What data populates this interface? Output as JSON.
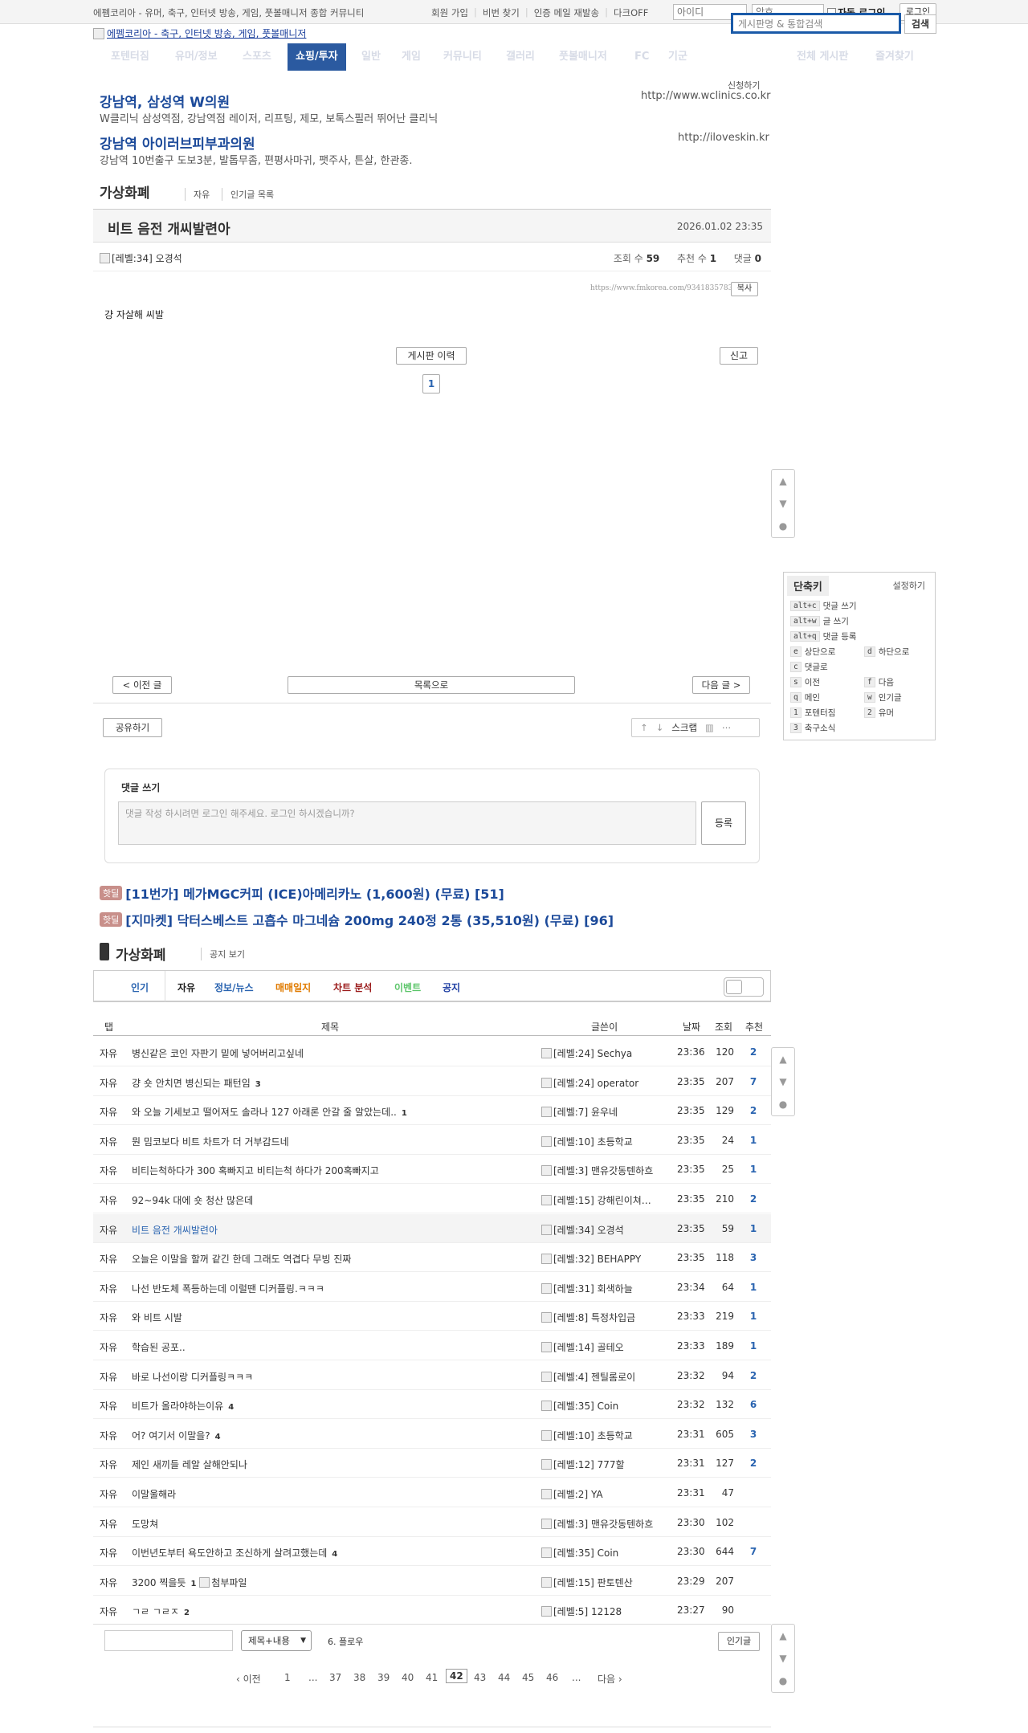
{
  "top": {
    "site_desc": "에펨코리아 - 유머, 축구, 인터넷 방송, 게임, 풋볼매니저 종합 커뮤니티",
    "links": [
      "회원 가입",
      "비번 찾기",
      "인증 메일 재발송",
      "다크OFF"
    ],
    "id_placeholder": "아이디",
    "pw_placeholder": "암호",
    "auto_login": "자동 로그인",
    "login": "로그인"
  },
  "header": {
    "logo_alt": "에펨코리아 - 축구, 인터넷 방송, 게임, 풋볼매니저",
    "search_placeholder": "게시판명 & 통합검색",
    "search_btn": "검색"
  },
  "nav": {
    "items": [
      "포텐터짐",
      "유머/정보",
      "스포츠",
      "쇼핑/투자",
      "일반",
      "게임",
      "커뮤니티",
      "갤러리",
      "풋볼매니저",
      "FC",
      "기군"
    ],
    "right": [
      "전체 게시판",
      "즐겨찾기"
    ]
  },
  "ads": {
    "apply": "신청하기",
    "items": [
      {
        "title": "강남역, 삼성역 W의원",
        "desc": "W클리닉 삼성역점, 강남역점 레이저, 리프팅, 제모, 보톡스필러 뛰어난 클리닉",
        "url": "http://www.wclinics.co.kr"
      },
      {
        "title": "강남역 아이러브피부과의원",
        "desc": "강남역 10번출구 도보3분, 발톱무좀, 편평사마귀, 팻주사, 튼살, 한관종.",
        "url": "http://iloveskin.kr"
      }
    ]
  },
  "board": {
    "name": "가상화폐",
    "sub1": "자유",
    "sub2": "인기글 목록"
  },
  "post": {
    "title": "비트 음전 개씨발련아",
    "date": "2026.01.02 23:35",
    "author_level": "[레벨:34]",
    "author": "오경석",
    "views_label": "조회 수",
    "views": "59",
    "rec_label": "추천 수",
    "rec": "1",
    "cmt_label": "댓글",
    "cmt": "0",
    "url": "https://www.fmkorea.com/9341835783",
    "copy": "복사",
    "body": "걍 자살해 씨발",
    "history_btn": "게시판 이력",
    "report_btn": "신고",
    "page_num": "1"
  },
  "post_nav": {
    "prev": "< 이전 글",
    "list": "목록으로",
    "next": "다음 글 >",
    "share": "공유하기",
    "scrap": "스크랩"
  },
  "shortcut": {
    "title": "단축키",
    "settings": "설정하기",
    "rows": [
      {
        "key": "alt+c",
        "label": "댓글 쓰기"
      },
      {
        "key": "alt+w",
        "label": "글 쓰기"
      },
      {
        "key": "alt+q",
        "label": "댓글 등록"
      }
    ],
    "pairs": [
      [
        {
          "key": "e",
          "label": "상단으로"
        },
        {
          "key": "d",
          "label": "하단으로"
        }
      ],
      [
        {
          "key": "c",
          "label": "댓글로"
        },
        null
      ],
      [
        {
          "key": "s",
          "label": "이전"
        },
        {
          "key": "f",
          "label": "다음"
        }
      ],
      [
        {
          "key": "q",
          "label": "메인"
        },
        {
          "key": "w",
          "label": "인기글"
        }
      ],
      [
        {
          "key": "1",
          "label": "포텐터짐"
        },
        {
          "key": "2",
          "label": "유머"
        }
      ],
      [
        {
          "key": "3",
          "label": "축구소식"
        },
        null
      ]
    ]
  },
  "comment": {
    "title": "댓글 쓰기",
    "placeholder": "댓글 작성 하시려면 로그인 해주세요. 로그인 하시겠습니까?",
    "submit": "등록"
  },
  "hotdeals": [
    {
      "tag": "핫딜",
      "text": "[11번가] 메가MGC커피 (ICE)아메리카노 (1,600원) (무료) [51]"
    },
    {
      "tag": "핫딜",
      "text": "[지마켓] 닥터스베스트 고흡수 마그네슘 200mg 240정 2통 (35,510원) (무료) [96]"
    }
  ],
  "list_board": {
    "name": "가상화폐",
    "notice_link": "공지 보기",
    "tabs": [
      {
        "label": "인기",
        "color": "#2a64b0"
      },
      {
        "label": "자유",
        "color": "#222222"
      },
      {
        "label": "정보/뉴스",
        "color": "#2a64b0"
      },
      {
        "label": "매매일지",
        "color": "#e07b00"
      },
      {
        "label": "차트 분석",
        "color": "#9b1c1c"
      },
      {
        "label": "이벤트",
        "color": "#5cc56a"
      },
      {
        "label": "공지",
        "color": "#1f3fa3"
      }
    ],
    "headers": {
      "cat": "탭",
      "title": "제목",
      "author": "글쓴이",
      "date": "날짜",
      "views": "조회",
      "rec": "추천"
    }
  },
  "rows": [
    {
      "cat": "자유",
      "title": "병신같은 코인 자판기 밑에 넣어버리고싶네",
      "cnt": "",
      "level": "[레벨:24]",
      "author": "Sechya",
      "time": "23:36",
      "views": "120",
      "rec": "2"
    },
    {
      "cat": "자유",
      "title": "걍 숏 안치면 병신되는 패턴임",
      "cnt": "3",
      "level": "[레벨:24]",
      "author": "operator",
      "time": "23:35",
      "views": "207",
      "rec": "7"
    },
    {
      "cat": "자유",
      "title": "와 오늘 기세보고 떨어져도 솔라나 127 아래론 안갈 줄 알았는데..",
      "cnt": "1",
      "level": "[레벨:7]",
      "author": "윤우네",
      "time": "23:35",
      "views": "129",
      "rec": "2"
    },
    {
      "cat": "자유",
      "title": "뭔 밈코보다 비트 차트가 더 거부감드네",
      "cnt": "",
      "level": "[레벨:10]",
      "author": "초등학교",
      "time": "23:35",
      "views": "24",
      "rec": "1"
    },
    {
      "cat": "자유",
      "title": "비티는척하다가 300 혹빠지고 비티는척 하다가 200혹빠지고",
      "cnt": "",
      "level": "[레벨:3]",
      "author": "맨유갓동텐하흐",
      "time": "23:35",
      "views": "25",
      "rec": "1"
    },
    {
      "cat": "자유",
      "title": "92~94k 대에 숏 청산 많은데",
      "cnt": "",
      "level": "[레벨:15]",
      "author": "강해린이쳐…",
      "time": "23:35",
      "views": "210",
      "rec": "2"
    },
    {
      "cat": "자유",
      "title": "비트 음전 개씨발련아",
      "cnt": "",
      "level": "[레벨:34]",
      "author": "오경석",
      "time": "23:35",
      "views": "59",
      "rec": "1",
      "current": true
    },
    {
      "cat": "자유",
      "title": "오늘은 이말을 할꺼 같긴 한데 그래도 역겹다 무빙 진짜",
      "cnt": "",
      "level": "[레벨:32]",
      "author": "BEHAPPY",
      "time": "23:35",
      "views": "118",
      "rec": "3"
    },
    {
      "cat": "자유",
      "title": "나선 반도체 폭등하는데 이럴땐 디커플링.ㅋㅋㅋ",
      "cnt": "",
      "level": "[레벨:31]",
      "author": "회색하늘",
      "time": "23:34",
      "views": "64",
      "rec": "1"
    },
    {
      "cat": "자유",
      "title": "와 비트 시발",
      "cnt": "",
      "level": "[레벨:8]",
      "author": "특정차입금",
      "time": "23:33",
      "views": "219",
      "rec": "1"
    },
    {
      "cat": "자유",
      "title": "학습된 공포..",
      "cnt": "",
      "level": "[레벨:14]",
      "author": "골테오",
      "time": "23:33",
      "views": "189",
      "rec": "1"
    },
    {
      "cat": "자유",
      "title": "바로 나선이랑 디커플링ㅋㅋㅋ",
      "cnt": "",
      "level": "[레벨:4]",
      "author": "젠틸롬로이",
      "time": "23:32",
      "views": "94",
      "rec": "2"
    },
    {
      "cat": "자유",
      "title": "비트가 올라야하는이유",
      "cnt": "4",
      "level": "[레벨:35]",
      "author": "Coin",
      "time": "23:32",
      "views": "132",
      "rec": "6"
    },
    {
      "cat": "자유",
      "title": "어? 여기서 이말을?",
      "cnt": "4",
      "level": "[레벨:10]",
      "author": "초등학교",
      "time": "23:31",
      "views": "605",
      "rec": "3"
    },
    {
      "cat": "자유",
      "title": "제인 새끼들 레알 살해안되나",
      "cnt": "",
      "level": "[레벨:12]",
      "author": "777할",
      "time": "23:31",
      "views": "127",
      "rec": "2"
    },
    {
      "cat": "자유",
      "title": "이말울해라",
      "cnt": "",
      "level": "[레벨:2]",
      "author": "YA",
      "time": "23:31",
      "views": "47",
      "rec": ""
    },
    {
      "cat": "자유",
      "title": "도망쳐",
      "cnt": "",
      "level": "[레벨:3]",
      "author": "맨유갓동텐하흐",
      "time": "23:30",
      "views": "102",
      "rec": ""
    },
    {
      "cat": "자유",
      "title": "이번년도부터 욕도안하고 조신하게 살려고했는데",
      "cnt": "4",
      "level": "[레벨:35]",
      "author": "Coin",
      "time": "23:30",
      "views": "644",
      "rec": "7"
    },
    {
      "cat": "자유",
      "title": "3200 찍을듯",
      "cnt": "1",
      "level": "[레벨:15]",
      "author": "판토텐산",
      "time": "23:29",
      "views": "207",
      "rec": "",
      "attach": "첨부파일"
    },
    {
      "cat": "자유",
      "title": "ㄱㄹ ㄱㄹㅈ",
      "cnt": "2",
      "level": "[레벨:5]",
      "author": "12128",
      "time": "23:27",
      "views": "90",
      "rec": ""
    }
  ],
  "list_footer": {
    "search_select": "제목+내용",
    "follow": "6. 플로우",
    "popular_btn": "인기글",
    "prev": "‹ 이전",
    "next": "다음 ›",
    "pages": [
      "1",
      "...",
      "37",
      "38",
      "39",
      "40",
      "41",
      "42",
      "43",
      "44",
      "45",
      "46",
      "..."
    ],
    "current_page": "42"
  }
}
